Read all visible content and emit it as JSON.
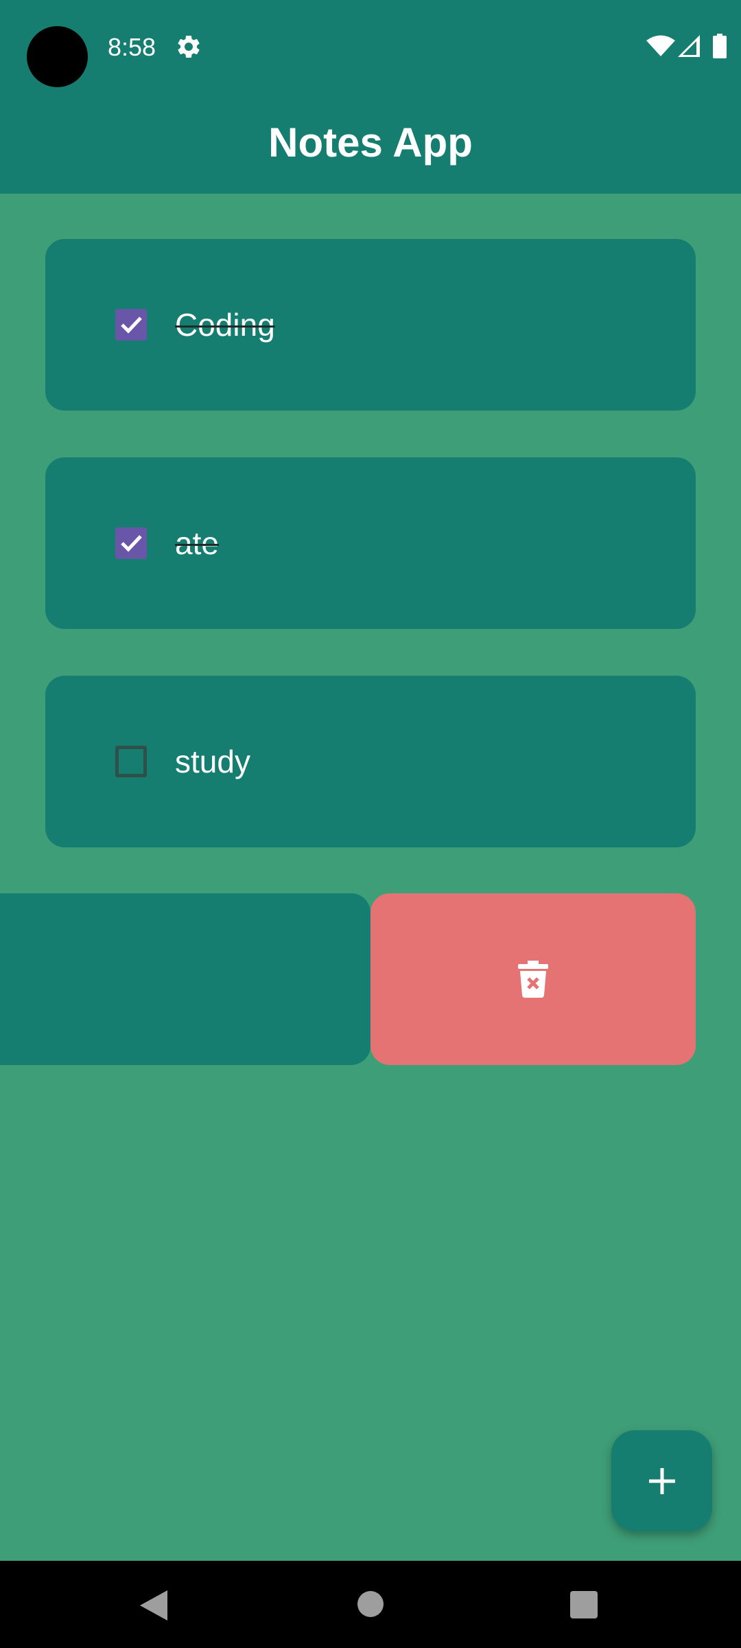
{
  "status_bar": {
    "time": "8:58",
    "icons": [
      "settings-icon",
      "wifi-icon",
      "signal-icon",
      "battery-icon"
    ]
  },
  "app_bar": {
    "title": "Notes App"
  },
  "notes": [
    {
      "text": "Coding",
      "checked": true
    },
    {
      "text": "ate",
      "checked": true
    },
    {
      "text": "study",
      "checked": false
    }
  ],
  "swipe_row": {
    "action_icon": "delete-icon"
  },
  "fab": {
    "icon": "plus-icon"
  },
  "nav_bar": {
    "icons": [
      "back-icon",
      "home-icon",
      "recents-icon"
    ]
  },
  "colors": {
    "app_bar": "#167e71",
    "background": "#3e9e77",
    "card": "#167e71",
    "checkbox_checked": "#6a56a8",
    "delete_background": "#e57373",
    "text": "#ffffff"
  }
}
